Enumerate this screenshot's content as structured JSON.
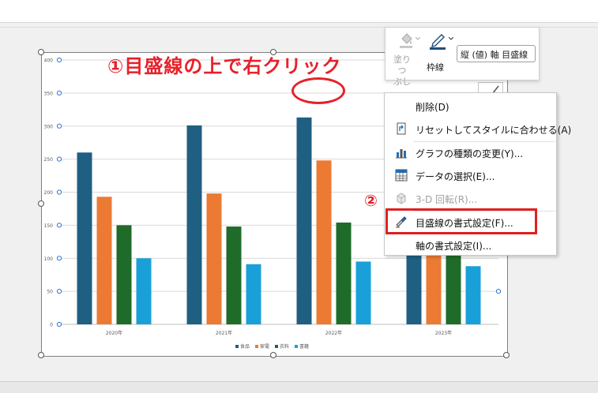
{
  "annotation_step1": "①目盛線の上で右クリック",
  "annotation_step2": "②",
  "mini_toolbar": {
    "fill_label_line1": "塗りつ",
    "fill_label_line2": "ぶし",
    "outline_label": "枠線",
    "element_select_value": "縦 (値) 軸 目盛線"
  },
  "context_menu": {
    "items": [
      {
        "label": "削除(D)",
        "icon": "none",
        "enabled": true
      },
      {
        "label": "リセットしてスタイルに合わせる(A)",
        "icon": "reset-style-icon",
        "enabled": true
      },
      {
        "label": "グラフの種類の変更(Y)...",
        "icon": "chart-type-icon",
        "enabled": true
      },
      {
        "label": "データの選択(E)...",
        "icon": "select-data-icon",
        "enabled": true
      },
      {
        "label": "3-D 回転(R)...",
        "icon": "3d-rotation-icon",
        "enabled": false
      },
      {
        "label": "目盛線の書式設定(F)...",
        "icon": "format-gridlines-icon",
        "enabled": true
      },
      {
        "label": "軸の書式設定(I)...",
        "icon": "none",
        "enabled": true
      }
    ]
  },
  "chart_data": {
    "type": "bar",
    "categories": [
      "2020年",
      "2021年",
      "2022年",
      "2023年"
    ],
    "series": [
      {
        "name": "食品",
        "color": "#1f5f82",
        "values": [
          260,
          301,
          313,
          280
        ]
      },
      {
        "name": "家電",
        "color": "#ec7a33",
        "values": [
          193,
          198,
          248,
          230
        ]
      },
      {
        "name": "衣料",
        "color": "#1f6b2a",
        "values": [
          150,
          148,
          154,
          140
        ]
      },
      {
        "name": "書籍",
        "color": "#1aa0d8",
        "values": [
          100,
          91,
          95,
          88
        ]
      }
    ],
    "yticks": [
      "0",
      "50",
      "100",
      "150",
      "200",
      "250",
      "300",
      "350",
      "400"
    ],
    "ylim": [
      0,
      400
    ],
    "grid": true,
    "legend": "bottom"
  }
}
